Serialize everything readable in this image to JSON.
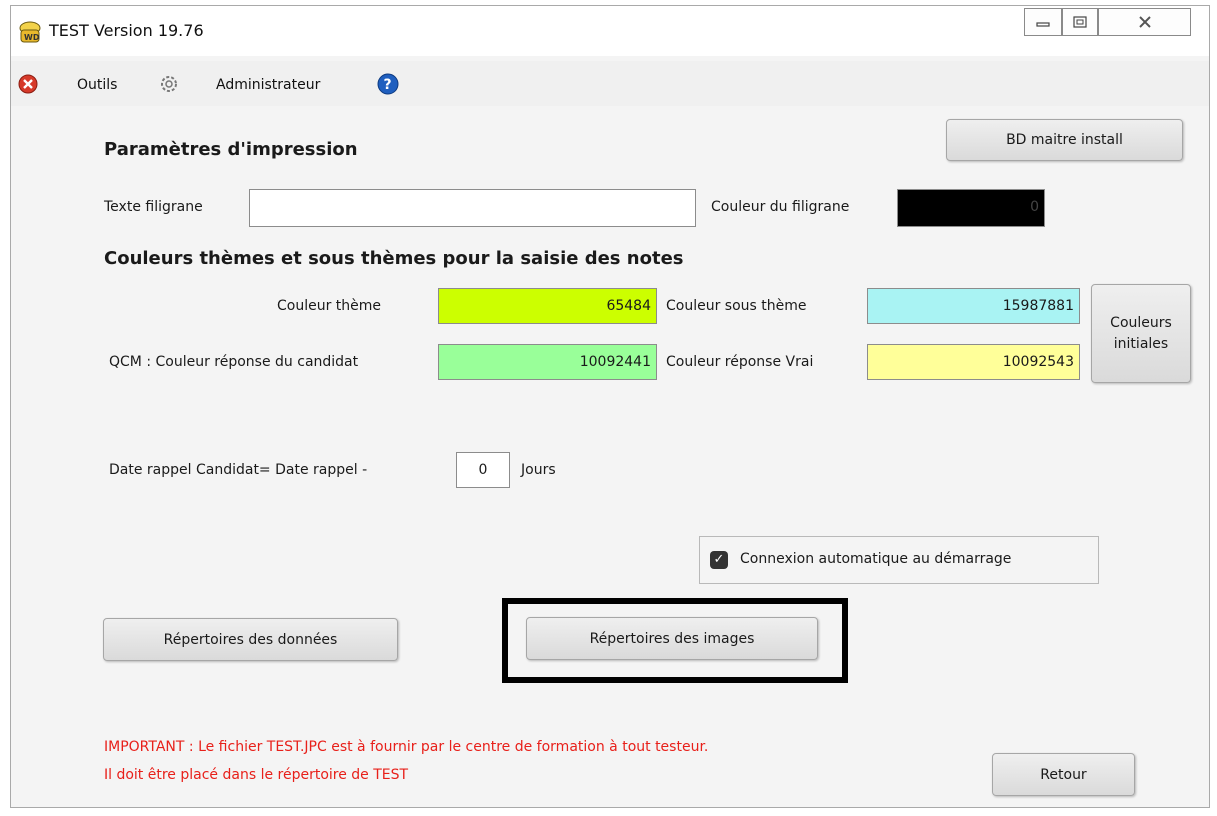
{
  "window": {
    "title": "TEST Version 19.76"
  },
  "menu": {
    "tools": "Outils",
    "admin": "Administrateur"
  },
  "print": {
    "heading": "Paramètres d'impression",
    "watermark_text_label": "Texte filigrane",
    "watermark_text_value": "",
    "watermark_color_label": "Couleur du filigrane",
    "watermark_color_value": "0",
    "watermark_color": "#000000"
  },
  "master_button": "BD maitre install",
  "colors": {
    "heading": "Couleurs thèmes et sous thèmes pour la saisie des notes",
    "theme_label": "Couleur thème",
    "theme_value": "65484",
    "theme_color": "#ccff00",
    "subtheme_label": "Couleur sous thème",
    "subtheme_value": "15987881",
    "subtheme_color": "#a9f3f3",
    "qcm_label": "QCM : Couleur réponse du candidat",
    "qcm_value": "10092441",
    "qcm_color": "#99ff99",
    "true_label": "Couleur réponse Vrai",
    "true_value": "10092543",
    "true_color": "#ffff99",
    "reset_button": "Couleurs initiales"
  },
  "reminder": {
    "label": "Date rappel Candidat= Date rappel -",
    "value": "0",
    "unit": "Jours"
  },
  "autoconnect": {
    "label": "Connexion automatique au démarrage",
    "checked": true
  },
  "buttons": {
    "data_dirs": "Répertoires des données",
    "image_dirs": "Répertoires des images",
    "back": "Retour"
  },
  "notice": {
    "line1": "IMPORTANT : Le fichier TEST.JPC est à fournir par le centre de formation à tout testeur.",
    "line2": "Il doit être placé dans  le répertoire de TEST"
  }
}
